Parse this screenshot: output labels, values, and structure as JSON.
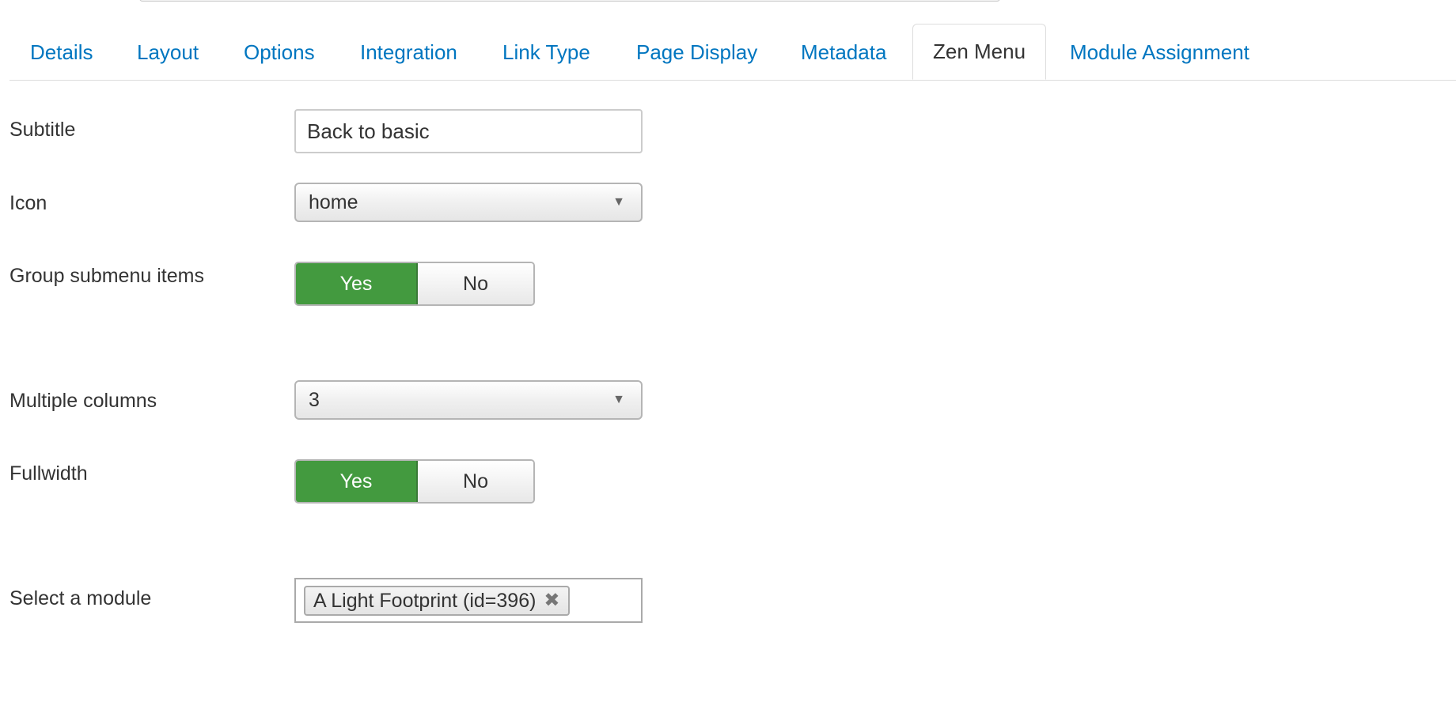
{
  "tabs": [
    {
      "label": "Details"
    },
    {
      "label": "Layout"
    },
    {
      "label": "Options"
    },
    {
      "label": "Integration"
    },
    {
      "label": "Link Type"
    },
    {
      "label": "Page Display"
    },
    {
      "label": "Metadata"
    },
    {
      "label": "Zen Menu",
      "active": true
    },
    {
      "label": "Module Assignment"
    }
  ],
  "form": {
    "subtitle": {
      "label": "Subtitle",
      "value": "Back to basic"
    },
    "icon": {
      "label": "Icon",
      "value": "home",
      "caret": "▼"
    },
    "group_submenu": {
      "label": "Group submenu items",
      "yes": "Yes",
      "no": "No",
      "selected": "Yes"
    },
    "columns": {
      "label": "Multiple columns",
      "value": "3",
      "caret": "▼"
    },
    "fullwidth": {
      "label": "Fullwidth",
      "yes": "Yes",
      "no": "No",
      "selected": "Yes"
    },
    "module": {
      "label": "Select a module",
      "chip": "A Light Footprint (id=396)",
      "remove_glyph": "✖"
    }
  },
  "colors": {
    "link": "#0076c0",
    "toggle_on": "#439a3f",
    "text": "#333333"
  }
}
